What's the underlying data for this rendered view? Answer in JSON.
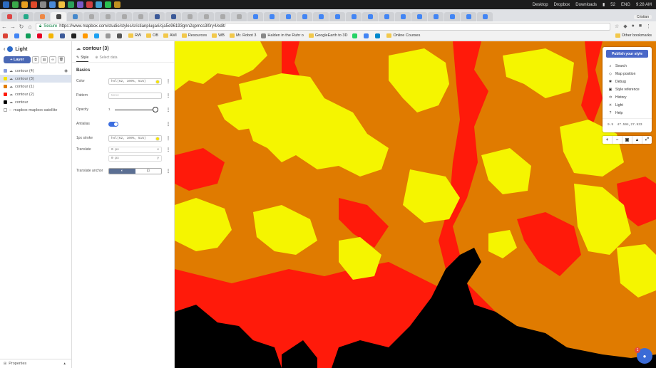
{
  "os": {
    "desktop": "Desktop",
    "dropbox": "Dropbox",
    "downloads": "Downloads",
    "battery": "52",
    "lang": "ENG",
    "time": "9:28 AM"
  },
  "browser": {
    "active_user": "Cristian",
    "secure_label": "Secure",
    "url": "https://www.mapbox.com/studio/styles/cristianplugari/cja5e96193gnn2qpmcs3l0ry4/edit/",
    "bookmarks": [
      {
        "label": "RW",
        "type": "folder"
      },
      {
        "label": "OB",
        "type": "folder"
      },
      {
        "label": "AMI",
        "type": "folder"
      },
      {
        "label": "Resources",
        "type": "folder"
      },
      {
        "label": "WB",
        "type": "folder"
      },
      {
        "label": "Mr. Robot 3",
        "type": "folder"
      },
      {
        "label": "Halden in the Ruhr o",
        "type": "site"
      },
      {
        "label": "GoogleEarth to 3D",
        "type": "folder"
      },
      {
        "label": "Online Courses",
        "type": "folder"
      }
    ],
    "other_bookmarks": "Other bookmarks"
  },
  "layers_panel": {
    "style_name": "Light",
    "add_layer": "+ Layer",
    "layers": [
      {
        "name": "contour (4)",
        "color": "#8aa0e0",
        "selected": false
      },
      {
        "name": "contour (3)",
        "color": "#f5e300",
        "selected": true
      },
      {
        "name": "contour (1)",
        "color": "#e07b00",
        "selected": false
      },
      {
        "name": "contour (2)",
        "color": "#ff1a0a",
        "selected": false
      },
      {
        "name": "contour",
        "color": "#000000",
        "selected": false
      },
      {
        "name": "mapbox-mapbox-satellite",
        "color": "#ffffff",
        "selected": false
      }
    ],
    "footer": "Properties"
  },
  "props_panel": {
    "title": "contour (3)",
    "tab_style": "Style",
    "tab_select_data": "Select data",
    "section": "Basics",
    "color_label": "Color",
    "color_value": "hsl(62, 100%, 51%)",
    "pattern_label": "Pattern",
    "pattern_placeholder": "None",
    "opacity_label": "Opacity",
    "opacity_value": "1",
    "antialias_label": "Antialias",
    "stroke_label": "1px stroke",
    "stroke_value": "hsl(62, 100%, 51%)",
    "translate_label": "Translate",
    "translate_x": "0 px",
    "translate_x_axis": "x",
    "translate_y": "0 px",
    "translate_y_axis": "y",
    "anchor_label": "Translate anchor"
  },
  "map_menu": {
    "publish": "Publish your style",
    "items": [
      {
        "label": "Search",
        "icon": "search-icon"
      },
      {
        "label": "Map position",
        "icon": "map-position-icon"
      },
      {
        "label": "Debug",
        "icon": "debug-icon"
      },
      {
        "label": "Style reference",
        "icon": "book-icon"
      },
      {
        "label": "History",
        "icon": "history-icon"
      },
      {
        "label": "Light",
        "icon": "light-icon"
      },
      {
        "label": "Help",
        "icon": "help-icon"
      }
    ],
    "zoom": "9.9",
    "coords": "47.594,27.933",
    "help_badge": "1"
  },
  "map_colors": {
    "black": "#000000",
    "red": "#ff1a0a",
    "orange": "#e07b00",
    "yellow": "#f5f500"
  }
}
